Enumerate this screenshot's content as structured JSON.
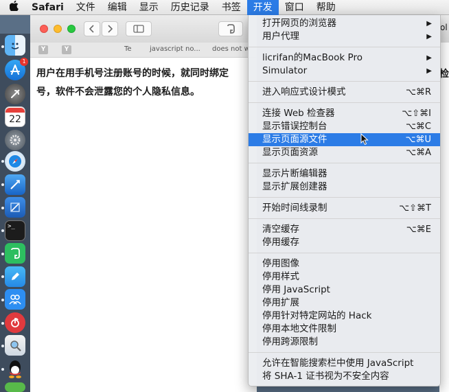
{
  "menubar": {
    "apple_icon": "apple-logo-icon",
    "app_name": "Safari",
    "items": [
      "文件",
      "编辑",
      "显示",
      "历史记录",
      "书签",
      "开发",
      "窗口",
      "帮助"
    ],
    "active": "开发"
  },
  "window": {
    "bookmarks": [
      "Te",
      "javascript no...",
      "does not w"
    ],
    "content_lines": [
      "用户在用手机号注册账号的时候，就同时绑定",
      "号，软件不会泄露您的个人隐私信息。"
    ],
    "right_edge_text": "ol",
    "right_edge_text2": "检"
  },
  "dock": {
    "icons": [
      "finder-icon",
      "app-store-icon",
      "launchpad-icon",
      "calendar-icon",
      "system-preferences-icon",
      "safari-icon",
      "xcode-icon",
      "xcode-alt-icon",
      "terminal-icon",
      "evernote-icon",
      "pencil-app-icon",
      "contacts-app-icon",
      "netease-music-icon",
      "preview-icon",
      "qq-icon"
    ],
    "app_store_badge": "1",
    "calendar_day": "22"
  },
  "dev_menu": {
    "groups": [
      [
        {
          "label": "打开网页的浏览器",
          "submenu": true
        },
        {
          "label": "用户代理",
          "submenu": true
        }
      ],
      [
        {
          "label": "licrifan的MacBook Pro",
          "submenu": true
        },
        {
          "label": "Simulator",
          "submenu": true
        }
      ],
      [
        {
          "label": "进入响应式设计模式",
          "shortcut": "⌥⌘R"
        }
      ],
      [
        {
          "label": "连接 Web 检查器",
          "shortcut": "⌥⇧⌘I"
        },
        {
          "label": "显示错误控制台",
          "shortcut": "⌥⌘C"
        },
        {
          "label": "显示页面源文件",
          "shortcut": "⌥⌘U",
          "highlighted": true
        },
        {
          "label": "显示页面资源",
          "shortcut": "⌥⌘A"
        }
      ],
      [
        {
          "label": "显示片断编辑器"
        },
        {
          "label": "显示扩展创建器"
        }
      ],
      [
        {
          "label": "开始时间线录制",
          "shortcut": "⌥⇧⌘T"
        }
      ],
      [
        {
          "label": "清空缓存",
          "shortcut": "⌥⌘E"
        },
        {
          "label": "停用缓存"
        }
      ],
      [
        {
          "label": "停用图像"
        },
        {
          "label": "停用样式"
        },
        {
          "label": "停用 JavaScript"
        },
        {
          "label": "停用扩展"
        },
        {
          "label": "停用针对特定网站的 Hack"
        },
        {
          "label": "停用本地文件限制"
        },
        {
          "label": "停用跨源限制"
        }
      ],
      [
        {
          "label": "允许在智能搜索栏中使用 JavaScript"
        },
        {
          "label": "将 SHA-1 证书视为不安全内容"
        }
      ]
    ],
    "submenu_icon": "chevron-right-icon"
  },
  "colors": {
    "highlight": "#2c7ce6",
    "menubar_bg": "#ececec"
  }
}
